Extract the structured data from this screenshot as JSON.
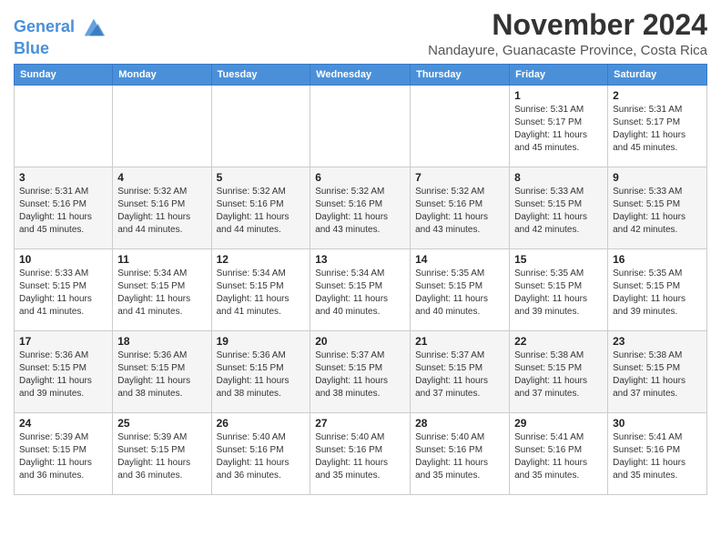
{
  "header": {
    "logo_line1": "General",
    "logo_line2": "Blue",
    "month_title": "November 2024",
    "location": "Nandayure, Guanacaste Province, Costa Rica"
  },
  "weekdays": [
    "Sunday",
    "Monday",
    "Tuesday",
    "Wednesday",
    "Thursday",
    "Friday",
    "Saturday"
  ],
  "weeks": [
    [
      {
        "day": "",
        "info": ""
      },
      {
        "day": "",
        "info": ""
      },
      {
        "day": "",
        "info": ""
      },
      {
        "day": "",
        "info": ""
      },
      {
        "day": "",
        "info": ""
      },
      {
        "day": "1",
        "info": "Sunrise: 5:31 AM\nSunset: 5:17 PM\nDaylight: 11 hours and 45 minutes."
      },
      {
        "day": "2",
        "info": "Sunrise: 5:31 AM\nSunset: 5:17 PM\nDaylight: 11 hours and 45 minutes."
      }
    ],
    [
      {
        "day": "3",
        "info": "Sunrise: 5:31 AM\nSunset: 5:16 PM\nDaylight: 11 hours and 45 minutes."
      },
      {
        "day": "4",
        "info": "Sunrise: 5:32 AM\nSunset: 5:16 PM\nDaylight: 11 hours and 44 minutes."
      },
      {
        "day": "5",
        "info": "Sunrise: 5:32 AM\nSunset: 5:16 PM\nDaylight: 11 hours and 44 minutes."
      },
      {
        "day": "6",
        "info": "Sunrise: 5:32 AM\nSunset: 5:16 PM\nDaylight: 11 hours and 43 minutes."
      },
      {
        "day": "7",
        "info": "Sunrise: 5:32 AM\nSunset: 5:16 PM\nDaylight: 11 hours and 43 minutes."
      },
      {
        "day": "8",
        "info": "Sunrise: 5:33 AM\nSunset: 5:15 PM\nDaylight: 11 hours and 42 minutes."
      },
      {
        "day": "9",
        "info": "Sunrise: 5:33 AM\nSunset: 5:15 PM\nDaylight: 11 hours and 42 minutes."
      }
    ],
    [
      {
        "day": "10",
        "info": "Sunrise: 5:33 AM\nSunset: 5:15 PM\nDaylight: 11 hours and 41 minutes."
      },
      {
        "day": "11",
        "info": "Sunrise: 5:34 AM\nSunset: 5:15 PM\nDaylight: 11 hours and 41 minutes."
      },
      {
        "day": "12",
        "info": "Sunrise: 5:34 AM\nSunset: 5:15 PM\nDaylight: 11 hours and 41 minutes."
      },
      {
        "day": "13",
        "info": "Sunrise: 5:34 AM\nSunset: 5:15 PM\nDaylight: 11 hours and 40 minutes."
      },
      {
        "day": "14",
        "info": "Sunrise: 5:35 AM\nSunset: 5:15 PM\nDaylight: 11 hours and 40 minutes."
      },
      {
        "day": "15",
        "info": "Sunrise: 5:35 AM\nSunset: 5:15 PM\nDaylight: 11 hours and 39 minutes."
      },
      {
        "day": "16",
        "info": "Sunrise: 5:35 AM\nSunset: 5:15 PM\nDaylight: 11 hours and 39 minutes."
      }
    ],
    [
      {
        "day": "17",
        "info": "Sunrise: 5:36 AM\nSunset: 5:15 PM\nDaylight: 11 hours and 39 minutes."
      },
      {
        "day": "18",
        "info": "Sunrise: 5:36 AM\nSunset: 5:15 PM\nDaylight: 11 hours and 38 minutes."
      },
      {
        "day": "19",
        "info": "Sunrise: 5:36 AM\nSunset: 5:15 PM\nDaylight: 11 hours and 38 minutes."
      },
      {
        "day": "20",
        "info": "Sunrise: 5:37 AM\nSunset: 5:15 PM\nDaylight: 11 hours and 38 minutes."
      },
      {
        "day": "21",
        "info": "Sunrise: 5:37 AM\nSunset: 5:15 PM\nDaylight: 11 hours and 37 minutes."
      },
      {
        "day": "22",
        "info": "Sunrise: 5:38 AM\nSunset: 5:15 PM\nDaylight: 11 hours and 37 minutes."
      },
      {
        "day": "23",
        "info": "Sunrise: 5:38 AM\nSunset: 5:15 PM\nDaylight: 11 hours and 37 minutes."
      }
    ],
    [
      {
        "day": "24",
        "info": "Sunrise: 5:39 AM\nSunset: 5:15 PM\nDaylight: 11 hours and 36 minutes."
      },
      {
        "day": "25",
        "info": "Sunrise: 5:39 AM\nSunset: 5:15 PM\nDaylight: 11 hours and 36 minutes."
      },
      {
        "day": "26",
        "info": "Sunrise: 5:40 AM\nSunset: 5:16 PM\nDaylight: 11 hours and 36 minutes."
      },
      {
        "day": "27",
        "info": "Sunrise: 5:40 AM\nSunset: 5:16 PM\nDaylight: 11 hours and 35 minutes."
      },
      {
        "day": "28",
        "info": "Sunrise: 5:40 AM\nSunset: 5:16 PM\nDaylight: 11 hours and 35 minutes."
      },
      {
        "day": "29",
        "info": "Sunrise: 5:41 AM\nSunset: 5:16 PM\nDaylight: 11 hours and 35 minutes."
      },
      {
        "day": "30",
        "info": "Sunrise: 5:41 AM\nSunset: 5:16 PM\nDaylight: 11 hours and 35 minutes."
      }
    ]
  ]
}
